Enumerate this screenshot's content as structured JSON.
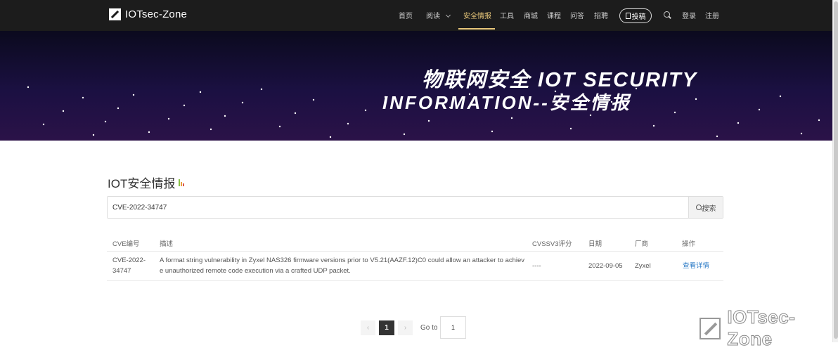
{
  "nav": {
    "brand": "IOTsec-Zone",
    "items": [
      "首页",
      "阅读",
      "安全情报",
      "工具",
      "商城",
      "课程",
      "问答",
      "招聘"
    ],
    "submit_label": "投稿",
    "login": "登录",
    "register": "注册"
  },
  "banner": {
    "line1": "物联网安全 IOT SECURITY",
    "line2": "INFORMATION--安全情报"
  },
  "section_title": "IOT安全情报",
  "search": {
    "value": "CVE-2022-34747",
    "button_label": "搜索"
  },
  "table": {
    "headers": [
      "CVE编号",
      "描述",
      "CVSSV3评分",
      "日期",
      "厂商",
      "操作"
    ],
    "rows": [
      {
        "cve_line1": "CVE-2022-",
        "cve_line2": "34747",
        "desc_line1": "A format string vulnerability in Zyxel NAS326 firmware versions prior to V5.21(AAZF.12)C0 could allow an attacker to achiev",
        "desc_line2": "e unauthorized remote code execution via a crafted UDP packet.",
        "score": "----",
        "date": "2022-09-05",
        "vendor": "Zyxel",
        "action": "查看详情"
      }
    ]
  },
  "pagination": {
    "prev": "‹",
    "next": "›",
    "current_page": "1",
    "goto_label": "Go to",
    "goto_value": "1"
  },
  "watermark": "IOTsec-Zone",
  "colors": {
    "accent": "#e8c77a",
    "link": "#2f7dc7",
    "nav_bg": "#1c1c1c"
  }
}
